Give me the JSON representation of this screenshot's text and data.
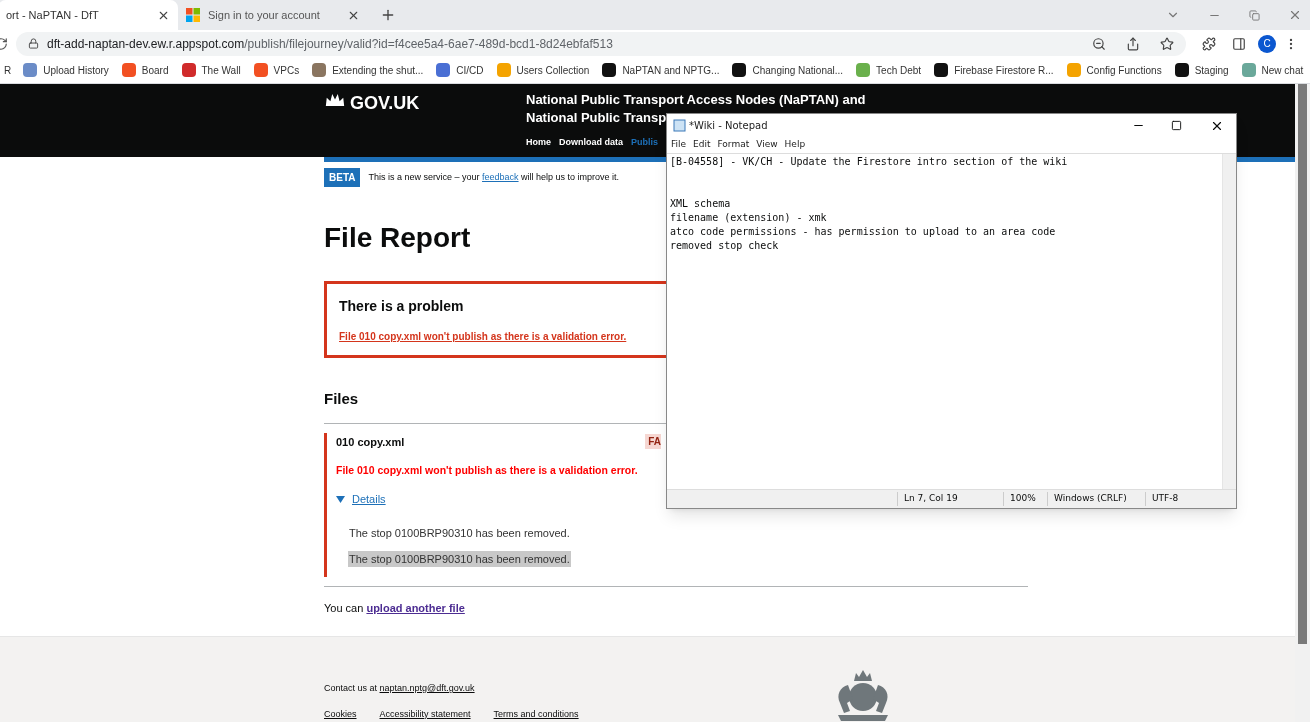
{
  "browser": {
    "tabs": [
      {
        "label": "ort - NaPTAN - DfT",
        "selected": true
      },
      {
        "label": "Sign in to your account",
        "selected": false
      }
    ],
    "address": {
      "domain": "dft-add-naptan-dev.ew.r.appspot.com",
      "path": "/publish/filejourney/valid?id=f4cee5a4-6ae7-489d-bcd1-8d24ebfaf513"
    },
    "profile_initial": "C",
    "bookmarks": [
      "R",
      "Upload History",
      "Board",
      "The Wall",
      "VPCs",
      "Extending the shut...",
      "CI/CD",
      "Users Collection",
      "NaPTAN and NPTG...",
      "Changing National...",
      "Tech Debt",
      "Firebase Firestore R...",
      "Config Functions",
      "Staging",
      "New chat"
    ]
  },
  "header": {
    "logo": "GOV.UK",
    "title_lines": [
      "National Public Transport Access Nodes (NaPTAN) and",
      "National Public Transp"
    ],
    "nav": [
      {
        "label": "Home",
        "selected": false
      },
      {
        "label": "Download data",
        "selected": false
      },
      {
        "label": "Publis",
        "selected": true
      }
    ]
  },
  "phase_banner": {
    "tag": "BETA",
    "before": "This is a new service – your ",
    "link": "feedback",
    "after": " will help us to improve it."
  },
  "page_title": "File Report",
  "error_summary": {
    "title": "There is a problem",
    "link": "File 010 copy.xml won't publish as there is a validation error."
  },
  "files": {
    "heading": "Files",
    "items": [
      {
        "name": "010 copy.xml",
        "status": "FA",
        "error": "File 010 copy.xml won't publish as there is a validation error.",
        "details": {
          "label": "Details",
          "expanded": true,
          "messages": [
            {
              "text": "The stop 0100BRP90310 has been removed.",
              "highlighted": false
            },
            {
              "text": "The stop 0100BRP90310 has been removed.",
              "highlighted": true
            }
          ]
        }
      }
    ]
  },
  "upload": {
    "before": "You can ",
    "link": "upload another file"
  },
  "footer": {
    "contact_before": "Contact us at ",
    "contact_link": "naptan.nptg@dft.gov.uk",
    "links": [
      "Cookies",
      "Accessibility statement",
      "Terms and conditions"
    ]
  },
  "notepad": {
    "title": "*Wiki - Notepad",
    "menu": [
      "File",
      "Edit",
      "Format",
      "View",
      "Help"
    ],
    "blocks": [
      [
        "[B-04558] - VK/CH - Update the Firestore intro section of the wiki"
      ],
      [
        "XML schema",
        "filename (extension) - xmk",
        "atco code permissions - has permission to upload to an area code",
        "removed stop check"
      ]
    ],
    "status": [
      "Ln 7, Col 19",
      "100%",
      "Windows (CRLF)",
      "UTF-8"
    ]
  }
}
